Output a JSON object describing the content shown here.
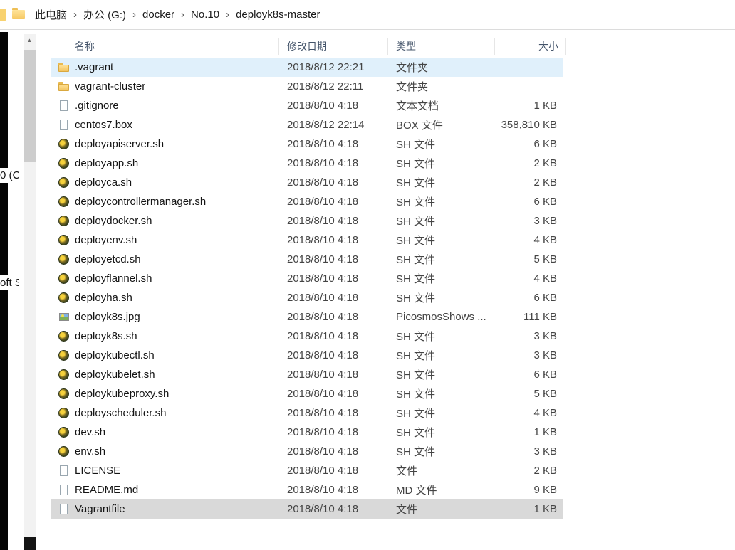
{
  "breadcrumb": {
    "items": [
      "此电脑",
      "办公 (G:)",
      "docker",
      "No.10",
      "deployk8s-master"
    ]
  },
  "sidebar": {
    "fragments": [
      "0 (C",
      "oft S"
    ]
  },
  "colors": {
    "hover_row": "#e0f0fb",
    "selected_row": "#d9d9d9",
    "header_text": "#44546a"
  },
  "table": {
    "columns": [
      {
        "label": "名称"
      },
      {
        "label": "修改日期"
      },
      {
        "label": "类型"
      },
      {
        "label": "大小"
      }
    ],
    "rows": [
      {
        "name": ".vagrant",
        "date": "2018/8/12 22:21",
        "type": "文件夹",
        "size": "",
        "icon": "folder",
        "state": "hover"
      },
      {
        "name": "vagrant-cluster",
        "date": "2018/8/12 22:11",
        "type": "文件夹",
        "size": "",
        "icon": "folder",
        "state": ""
      },
      {
        "name": ".gitignore",
        "date": "2018/8/10 4:18",
        "type": "文本文档",
        "size": "1 KB",
        "icon": "text",
        "state": ""
      },
      {
        "name": "centos7.box",
        "date": "2018/8/12 22:14",
        "type": "BOX 文件",
        "size": "358,810 KB",
        "icon": "file",
        "state": ""
      },
      {
        "name": "deployapiserver.sh",
        "date": "2018/8/10 4:18",
        "type": "SH 文件",
        "size": "6 KB",
        "icon": "sh",
        "state": ""
      },
      {
        "name": "deployapp.sh",
        "date": "2018/8/10 4:18",
        "type": "SH 文件",
        "size": "2 KB",
        "icon": "sh",
        "state": ""
      },
      {
        "name": "deployca.sh",
        "date": "2018/8/10 4:18",
        "type": "SH 文件",
        "size": "2 KB",
        "icon": "sh",
        "state": ""
      },
      {
        "name": "deploycontrollermanager.sh",
        "date": "2018/8/10 4:18",
        "type": "SH 文件",
        "size": "6 KB",
        "icon": "sh",
        "state": ""
      },
      {
        "name": "deploydocker.sh",
        "date": "2018/8/10 4:18",
        "type": "SH 文件",
        "size": "3 KB",
        "icon": "sh",
        "state": ""
      },
      {
        "name": "deployenv.sh",
        "date": "2018/8/10 4:18",
        "type": "SH 文件",
        "size": "4 KB",
        "icon": "sh",
        "state": ""
      },
      {
        "name": "deployetcd.sh",
        "date": "2018/8/10 4:18",
        "type": "SH 文件",
        "size": "5 KB",
        "icon": "sh",
        "state": ""
      },
      {
        "name": "deployflannel.sh",
        "date": "2018/8/10 4:18",
        "type": "SH 文件",
        "size": "4 KB",
        "icon": "sh",
        "state": ""
      },
      {
        "name": "deployha.sh",
        "date": "2018/8/10 4:18",
        "type": "SH 文件",
        "size": "6 KB",
        "icon": "sh",
        "state": ""
      },
      {
        "name": "deployk8s.jpg",
        "date": "2018/8/10 4:18",
        "type": "PicosmosShows ...",
        "size": "111 KB",
        "icon": "image",
        "state": ""
      },
      {
        "name": "deployk8s.sh",
        "date": "2018/8/10 4:18",
        "type": "SH 文件",
        "size": "3 KB",
        "icon": "sh",
        "state": ""
      },
      {
        "name": "deploykubectl.sh",
        "date": "2018/8/10 4:18",
        "type": "SH 文件",
        "size": "3 KB",
        "icon": "sh",
        "state": ""
      },
      {
        "name": "deploykubelet.sh",
        "date": "2018/8/10 4:18",
        "type": "SH 文件",
        "size": "6 KB",
        "icon": "sh",
        "state": ""
      },
      {
        "name": "deploykubeproxy.sh",
        "date": "2018/8/10 4:18",
        "type": "SH 文件",
        "size": "5 KB",
        "icon": "sh",
        "state": ""
      },
      {
        "name": "deployscheduler.sh",
        "date": "2018/8/10 4:18",
        "type": "SH 文件",
        "size": "4 KB",
        "icon": "sh",
        "state": ""
      },
      {
        "name": "dev.sh",
        "date": "2018/8/10 4:18",
        "type": "SH 文件",
        "size": "1 KB",
        "icon": "sh",
        "state": ""
      },
      {
        "name": "env.sh",
        "date": "2018/8/10 4:18",
        "type": "SH 文件",
        "size": "3 KB",
        "icon": "sh",
        "state": ""
      },
      {
        "name": "LICENSE",
        "date": "2018/8/10 4:18",
        "type": "文件",
        "size": "2 KB",
        "icon": "file",
        "state": ""
      },
      {
        "name": "README.md",
        "date": "2018/8/10 4:18",
        "type": "MD 文件",
        "size": "9 KB",
        "icon": "file",
        "state": ""
      },
      {
        "name": "Vagrantfile",
        "date": "2018/8/10 4:18",
        "type": "文件",
        "size": "1 KB",
        "icon": "file",
        "state": "selected"
      }
    ]
  }
}
